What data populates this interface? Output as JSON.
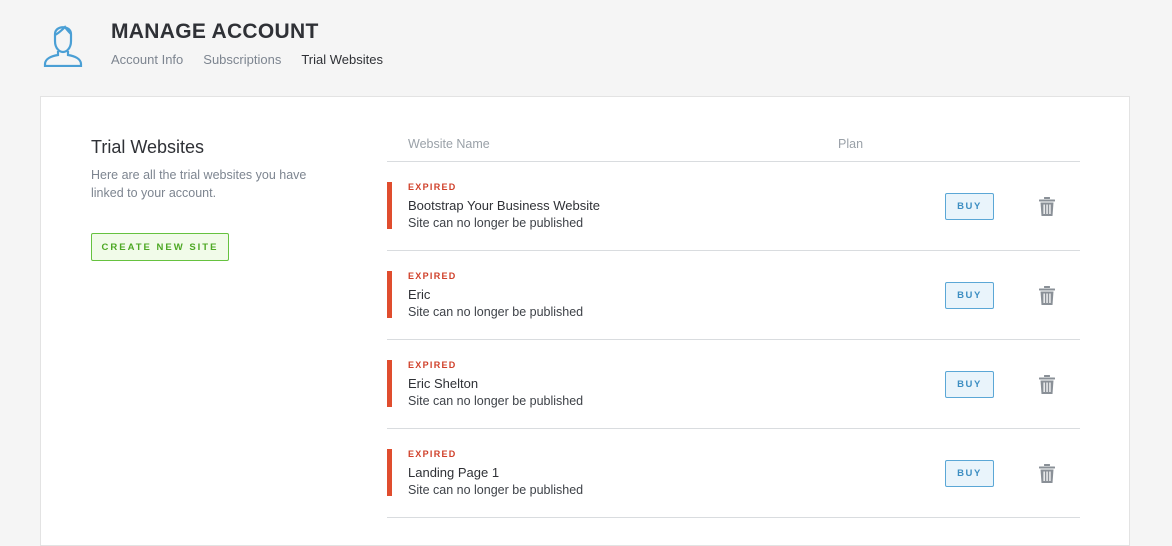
{
  "header": {
    "title": "MANAGE ACCOUNT",
    "tabs": [
      {
        "label": "Account Info",
        "active": false
      },
      {
        "label": "Subscriptions",
        "active": false
      },
      {
        "label": "Trial Websites",
        "active": true
      }
    ]
  },
  "sidebar": {
    "title": "Trial Websites",
    "description": "Here are all the trial websites you have linked to your account.",
    "create_label": "CREATE NEW SITE"
  },
  "table": {
    "columns": [
      "Website Name",
      "Plan"
    ],
    "rows": [
      {
        "status": "EXPIRED",
        "name": "Bootstrap Your Business Website",
        "note": "Site can no longer be published",
        "buy_label": "BUY"
      },
      {
        "status": "EXPIRED",
        "name": "Eric",
        "note": "Site can no longer be published",
        "buy_label": "BUY"
      },
      {
        "status": "EXPIRED",
        "name": "Eric Shelton",
        "note": "Site can no longer be published",
        "buy_label": "BUY"
      },
      {
        "status": "EXPIRED",
        "name": "Landing Page 1",
        "note": "Site can no longer be published",
        "buy_label": "BUY"
      }
    ]
  },
  "colors": {
    "accent_blue": "#4a9fd5",
    "expired_red": "#e04d2e",
    "create_green": "#66c23f"
  },
  "icons": {
    "avatar": "user-avatar-icon",
    "delete": "trash-icon"
  }
}
